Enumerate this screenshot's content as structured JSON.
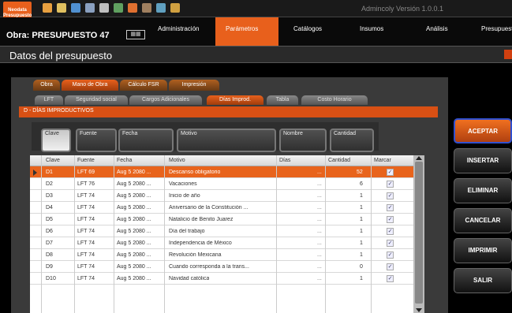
{
  "app": {
    "logo": "Neodata Presupuesto",
    "version": "Admincoly  Versión 1.0.0.1"
  },
  "obra": {
    "label": "Obra: PRESUPUESTO 47",
    "icon": "calendar-icon"
  },
  "menu": [
    {
      "label": "Administración"
    },
    {
      "label": "Parámetros",
      "active": true
    },
    {
      "label": "Catálogos"
    },
    {
      "label": "Insumos"
    },
    {
      "label": "Análisis"
    },
    {
      "label": "Presupuesto"
    }
  ],
  "window_title": "Datos del presupuesto",
  "tabs_main": [
    {
      "label": "Obra"
    },
    {
      "label": "Mano de Obra",
      "active": true
    },
    {
      "label": "Cálculo FSR"
    },
    {
      "label": "Impresión"
    }
  ],
  "tabs_sub": [
    {
      "label": "LFT"
    },
    {
      "label": "Seguridad social"
    },
    {
      "label": "Cargos Adicionales"
    },
    {
      "label": "Días Improd.",
      "active": true
    },
    {
      "label": "Tabla"
    },
    {
      "label": "Costo Horario"
    }
  ],
  "section_title": "D - DÍAS IMPRODUCTIVOS",
  "group_headers": [
    "Clave",
    "Fuente",
    "Fecha",
    "Motivo",
    "Nombre",
    "Cantidad"
  ],
  "columns": [
    "Clave",
    "Fuente",
    "Fecha",
    "Motivo",
    "Días",
    "Cantidad",
    "Marcar"
  ],
  "rows": [
    {
      "clave": "D1",
      "fuente": "LFT 69",
      "fecha": "Aug 5 2080 ...",
      "motivo": "Descanso obligatorio",
      "dias": "...",
      "cantidad": "52",
      "selected": true
    },
    {
      "clave": "D2",
      "fuente": "LFT 76",
      "fecha": "Aug 5 2080 ...",
      "motivo": "Vacaciones",
      "dias": "...",
      "cantidad": "6"
    },
    {
      "clave": "D3",
      "fuente": "LFT 74",
      "fecha": "Aug 5 2080 ...",
      "motivo": "Inicio de año",
      "dias": "...",
      "cantidad": "1"
    },
    {
      "clave": "D4",
      "fuente": "LFT 74",
      "fecha": "Aug 5 2080 ...",
      "motivo": "Aniversario de la Constitución ...",
      "dias": "...",
      "cantidad": "1"
    },
    {
      "clave": "D5",
      "fuente": "LFT 74",
      "fecha": "Aug 5 2080 ...",
      "motivo": "Natalicio de Benito Juarez",
      "dias": "...",
      "cantidad": "1"
    },
    {
      "clave": "D6",
      "fuente": "LFT 74",
      "fecha": "Aug 5 2080 ...",
      "motivo": "Día del trabajo",
      "dias": "...",
      "cantidad": "1"
    },
    {
      "clave": "D7",
      "fuente": "LFT 74",
      "fecha": "Aug 5 2080 ...",
      "motivo": "Independencia de México",
      "dias": "...",
      "cantidad": "1"
    },
    {
      "clave": "D8",
      "fuente": "LFT 74",
      "fecha": "Aug 5 2080 ...",
      "motivo": "Revolución Mexicana",
      "dias": "...",
      "cantidad": "1"
    },
    {
      "clave": "D9",
      "fuente": "LFT 74",
      "fecha": "Aug 5 2080 ...",
      "motivo": "Cuando corresponda a la trans...",
      "dias": "...",
      "cantidad": "0"
    },
    {
      "clave": "D10",
      "fuente": "LFT 74",
      "fecha": "Aug 5 2080 ...",
      "motivo": "Navidad católica",
      "dias": "...",
      "cantidad": "1"
    }
  ],
  "buttons": [
    "ACEPTAR",
    "INSERTAR",
    "ELIMINAR",
    "CANCELAR",
    "IMPRIMIR",
    "SALIR"
  ]
}
